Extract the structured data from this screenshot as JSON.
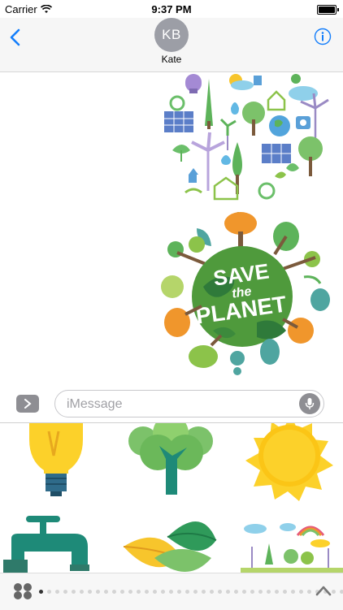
{
  "status_bar": {
    "carrier": "Carrier",
    "time": "9:37 PM"
  },
  "header": {
    "avatar_initials": "KB",
    "contact_name": "Kate"
  },
  "conversation": {
    "stickers": [
      {
        "icon": "eco-icons-sticker"
      },
      {
        "icon": "save-the-planet-sticker",
        "text_line1": "SAVE",
        "text_line2": "the",
        "text_line3": "PLANET"
      }
    ]
  },
  "input_bar": {
    "placeholder": "iMessage"
  },
  "sticker_drawer": {
    "items": [
      {
        "icon": "lightbulb-sticker"
      },
      {
        "icon": "tree-sticker"
      },
      {
        "icon": "sun-sticker"
      },
      {
        "icon": "water-tap-sticker"
      },
      {
        "icon": "leaves-sticker"
      },
      {
        "icon": "landscape-sticker"
      }
    ]
  },
  "pager": {
    "page_count": 38,
    "active_index": 0
  },
  "colors": {
    "ios_blue": "#147efb",
    "earth_green": "#4f9a3c",
    "sun_yellow": "#fcd12a"
  }
}
